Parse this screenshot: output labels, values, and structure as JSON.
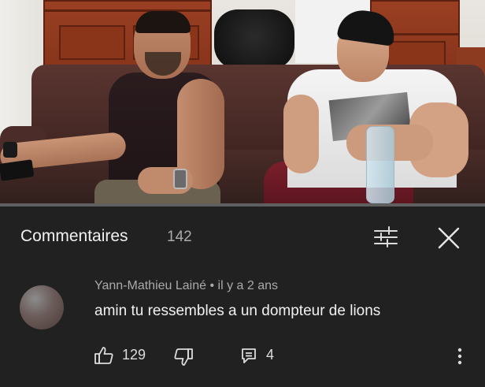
{
  "video": {
    "progress_fraction": 0.0
  },
  "comments_panel": {
    "title": "Commentaires",
    "count": "142",
    "icons": {
      "filter": "sort-filter-icon",
      "close": "close-icon"
    }
  },
  "comment": {
    "author": "Yann-Mathieu Lainé",
    "separator": "•",
    "time": "il y a 2 ans",
    "text": "amin tu ressembles a un dompteur de lions",
    "likes": "129",
    "replies": "4",
    "icons": {
      "like": "thumbs-up-icon",
      "dislike": "thumbs-down-icon",
      "reply": "reply-icon",
      "more": "more-vert-icon"
    }
  },
  "colors": {
    "background": "#212121",
    "progress": "#ff0000",
    "text_primary": "#f1f1f1",
    "text_secondary": "#aaaaaa"
  }
}
